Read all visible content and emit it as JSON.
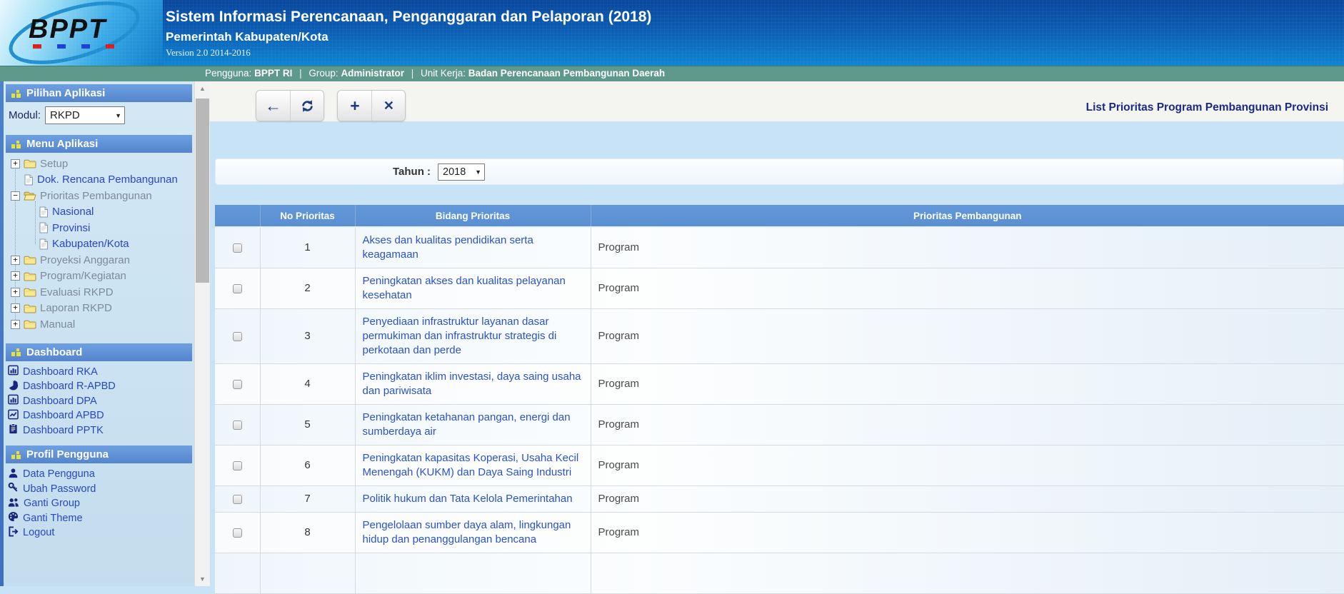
{
  "header": {
    "logo_text": "BPPT",
    "title": "Sistem Informasi Perencanaan, Penganggaran dan Pelaporan (2018)",
    "subtitle": "Pemerintah Kabupaten/Kota",
    "version": "Version 2.0 2014-2016"
  },
  "user_bar": {
    "pengguna_label": "Pengguna:",
    "pengguna_value": "BPPT RI",
    "separator": "|",
    "group_label": "Group:",
    "group_value": "Administrator",
    "unit_kerja_label": "Unit Kerja:",
    "unit_kerja_value": "Badan Perencanaan Pembangunan Daerah"
  },
  "sidebar": {
    "pilihan_aplikasi": {
      "title": "Pilihan Aplikasi",
      "modul_label": "Modul:",
      "modul_value": "RKPD"
    },
    "menu_aplikasi": {
      "title": "Menu Aplikasi",
      "tree": [
        {
          "label": "Setup",
          "icon": "folder-closed-icon",
          "expander": "+",
          "link": false
        },
        {
          "label": "Dok. Rencana Pembangunan",
          "icon": "document-icon",
          "link": true
        },
        {
          "label": "Prioritas Pembangunan",
          "icon": "folder-open-icon",
          "expander": "-",
          "link": false,
          "children": [
            {
              "label": "Nasional",
              "icon": "document-icon",
              "link": true
            },
            {
              "label": "Provinsi",
              "icon": "document-icon",
              "link": true
            },
            {
              "label": "Kabupaten/Kota",
              "icon": "document-icon",
              "link": true
            }
          ]
        },
        {
          "label": "Proyeksi Anggaran",
          "icon": "folder-closed-icon",
          "expander": "+",
          "link": false
        },
        {
          "label": "Program/Kegiatan",
          "icon": "folder-closed-icon",
          "expander": "+",
          "link": false
        },
        {
          "label": "Evaluasi RKPD",
          "icon": "folder-closed-icon",
          "expander": "+",
          "link": false
        },
        {
          "label": "Laporan RKPD",
          "icon": "folder-closed-icon",
          "expander": "+",
          "link": false
        },
        {
          "label": "Manual",
          "icon": "folder-closed-icon",
          "expander": "+",
          "link": false
        }
      ]
    },
    "dashboard": {
      "title": "Dashboard",
      "items": [
        {
          "label": "Dashboard RKA",
          "icon": "bar-chart-icon"
        },
        {
          "label": "Dashboard R-APBD",
          "icon": "pie-chart-icon"
        },
        {
          "label": "Dashboard DPA",
          "icon": "bar-chart-icon"
        },
        {
          "label": "Dashboard APBD",
          "icon": "line-chart-icon"
        },
        {
          "label": "Dashboard PPTK",
          "icon": "clipboard-icon"
        }
      ]
    },
    "profil": {
      "title": "Profil Pengguna",
      "items": [
        {
          "label": "Data Pengguna",
          "icon": "user-icon"
        },
        {
          "label": "Ubah Password",
          "icon": "key-icon"
        },
        {
          "label": "Ganti Group",
          "icon": "users-icon"
        },
        {
          "label": "Ganti Theme",
          "icon": "palette-icon"
        },
        {
          "label": "Logout",
          "icon": "logout-icon"
        }
      ]
    }
  },
  "toolbar": {
    "back_glyph": "←",
    "add_glyph": "+",
    "close_glyph": "✕",
    "page_title": "List Prioritas Program Pembangunan Provinsi"
  },
  "filter": {
    "tahun_label": "Tahun :",
    "tahun_value": "2018"
  },
  "table": {
    "headers": [
      "No Prioritas",
      "Bidang Prioritas",
      "Prioritas Pembangunan"
    ],
    "rows": [
      {
        "no": "1",
        "bidang": "Akses dan kualitas pendidikan serta keagamaan",
        "prioritas": "Program"
      },
      {
        "no": "2",
        "bidang": "Peningkatan akses dan kualitas pelayanan kesehatan",
        "prioritas": "Program"
      },
      {
        "no": "3",
        "bidang": "Penyediaan infrastruktur layanan dasar permukiman dan infrastruktur strategis di perkotaan dan perde",
        "prioritas": "Program"
      },
      {
        "no": "4",
        "bidang": "Peningkatan iklim investasi, daya saing usaha dan pariwisata",
        "prioritas": "Program"
      },
      {
        "no": "5",
        "bidang": "Peningkatan ketahanan pangan, energi dan sumberdaya air",
        "prioritas": "Program"
      },
      {
        "no": "6",
        "bidang": "Peningkatan kapasitas Koperasi, Usaha Kecil Menengah (KUKM) dan Daya Saing Industri",
        "prioritas": "Program"
      },
      {
        "no": "7",
        "bidang": "Politik hukum dan Tata Kelola Pemerintahan",
        "prioritas": "Program"
      },
      {
        "no": "8",
        "bidang": "Pengelolaan sumber daya alam, lingkungan hidup dan penanggulangan bencana",
        "prioritas": "Program"
      }
    ]
  },
  "colors": {
    "header_blue_top": "#09479e",
    "header_blue_bottom": "#0f85d2",
    "user_bar_green": "#5f998b",
    "section_header_blue": "#5e90d8",
    "table_header_blue": "#5e94d6",
    "link_blue": "#2946c6",
    "accent_yellow": "#e8e03a",
    "page_bg_blue": "#c7e3f5",
    "title_navy": "#1b2a85"
  }
}
